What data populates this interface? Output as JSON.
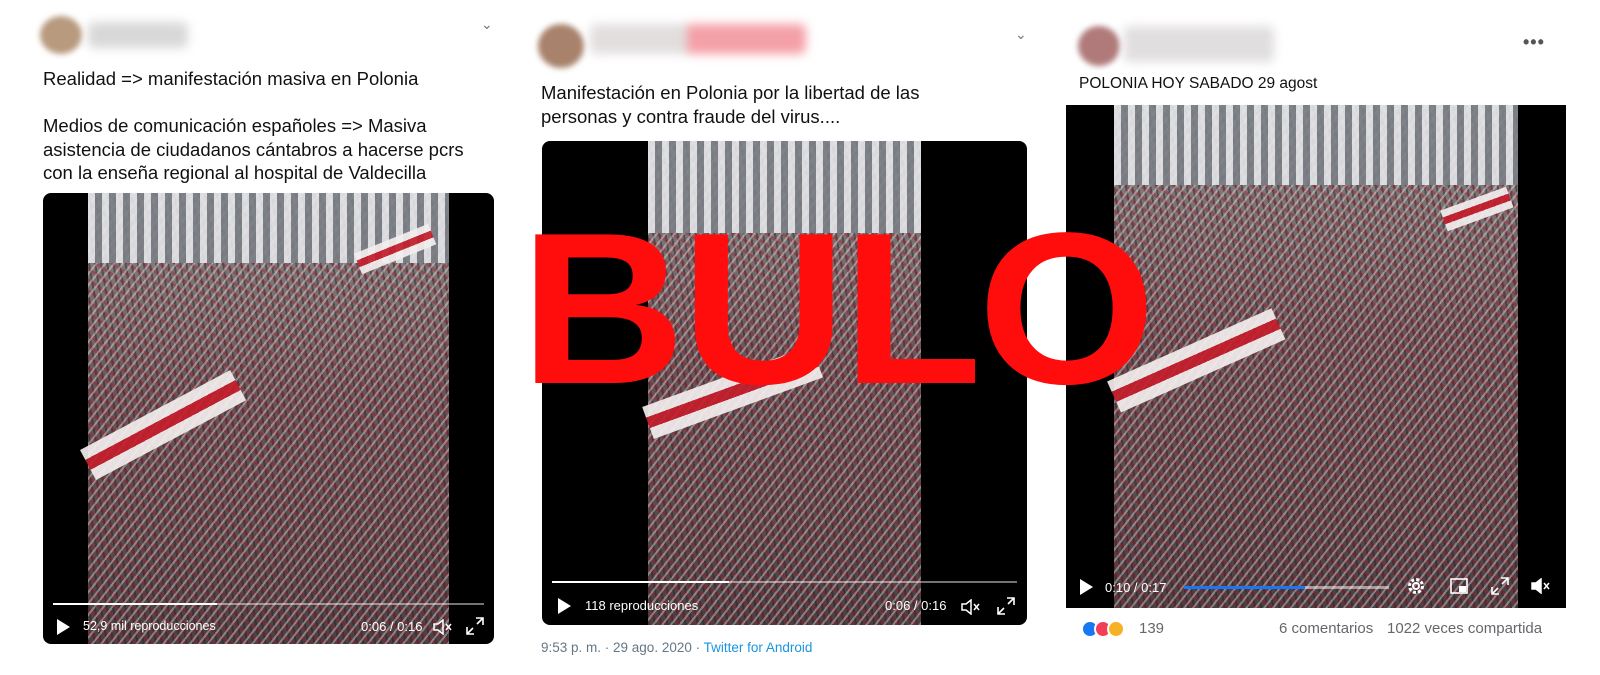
{
  "panel1": {
    "text": "Realidad => manifestación masiva en Polonia\n\nMedios de comunicación españoles => Masiva asistencia de ciudadanos cántabros a hacerse pcrs con la enseña regional al hospital de Valdecilla",
    "views": "52,9 mil reproducciones",
    "time": "0:06 / 0:16",
    "progress": 0.38
  },
  "panel2": {
    "text": "Manifestación en Polonia por la libertad de las personas y contra fraude del virus....",
    "views": "118 reproducciones",
    "time": "0:06 / 0:16",
    "progress": 0.38,
    "meta_time": "9:53 p. m. · 29 ago. 2020 · ",
    "meta_source": "Twitter for Android"
  },
  "panel3": {
    "text": "POLONIA HOY SABADO 29 agost",
    "time": "0:10 / 0:17",
    "progress": 0.59,
    "reaction_count": "139",
    "comments": "6 comentarios",
    "shares": "1022 veces compartida"
  },
  "overlay": {
    "stamp": "BULO"
  },
  "icons": [
    "chevron-down-icon",
    "more-options-icon",
    "play-icon",
    "volume-icon",
    "fullscreen-icon",
    "settings-icon",
    "pip-icon",
    "like-reaction-icon",
    "love-reaction-icon",
    "wow-reaction-icon"
  ],
  "colors": {
    "stamp_red": "#ff0d0d",
    "twitter_link": "#1b95e0",
    "facebook_blue": "#1877f2",
    "flag_red": "#c41d2b"
  }
}
